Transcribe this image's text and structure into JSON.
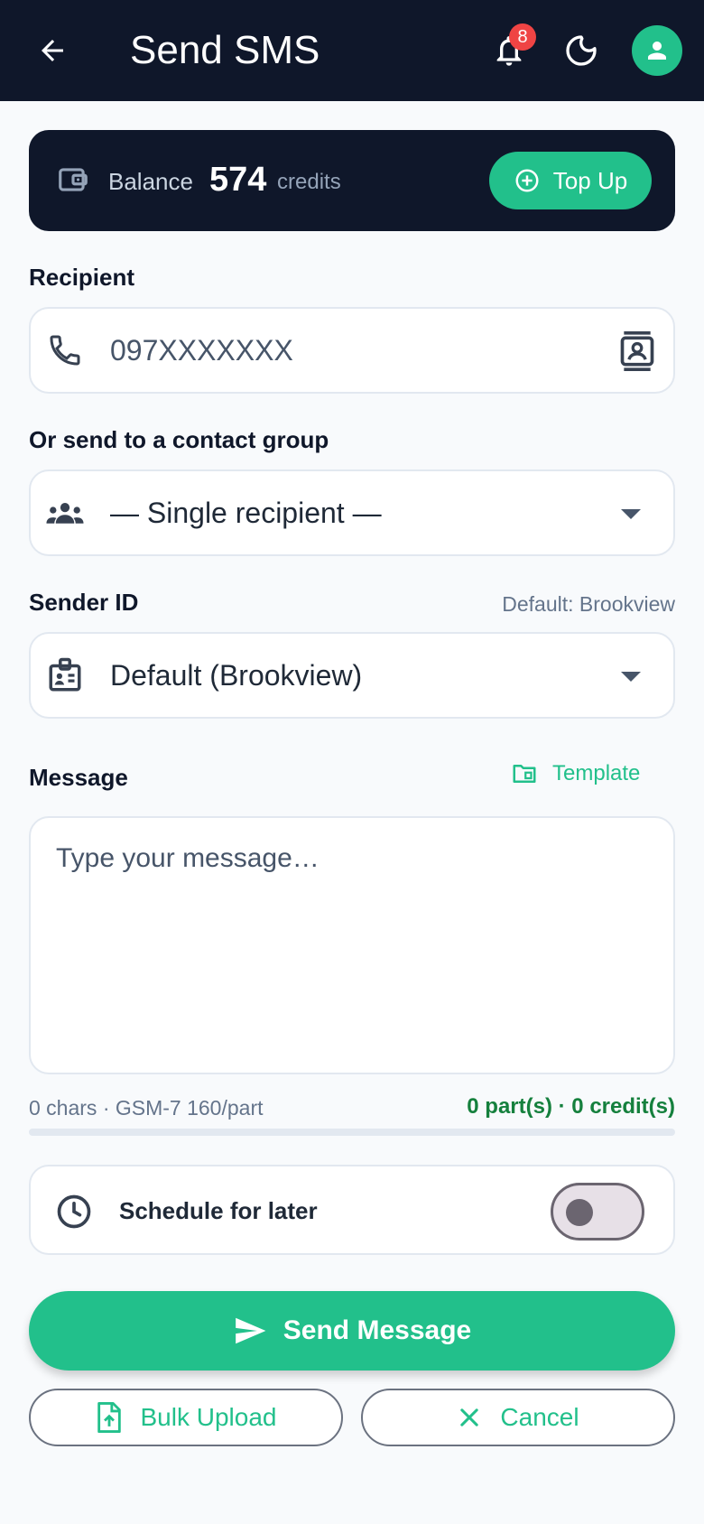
{
  "header": {
    "title": "Send SMS",
    "notification_count": "8"
  },
  "balance": {
    "label": "Balance",
    "amount": "574",
    "unit": "credits",
    "topup_label": "Top Up"
  },
  "recipient": {
    "label": "Recipient",
    "placeholder": "097XXXXXXX"
  },
  "group": {
    "label": "Or send to a contact group",
    "selected": "— Single recipient —"
  },
  "sender": {
    "label": "Sender ID",
    "hint": "Default: Brookview",
    "selected": "Default (Brookview)"
  },
  "message": {
    "label": "Message",
    "template_label": "Template",
    "placeholder": "Type your message…",
    "value": "",
    "char_info": "0 chars · GSM-7 160/part",
    "cost_info": "0 part(s) · 0 credit(s)",
    "progress_fraction": 0
  },
  "schedule": {
    "label": "Schedule for later",
    "enabled": false
  },
  "actions": {
    "send_label": "Send Message",
    "bulk_label": "Bulk Upload",
    "cancel_label": "Cancel"
  },
  "colors": {
    "header_bg": "#0f172a",
    "accent": "#22c08b",
    "badge": "#ef4444",
    "cost_text": "#15803d"
  },
  "icons": [
    "back-arrow-icon",
    "bell-icon",
    "moon-icon",
    "user-icon",
    "wallet-icon",
    "plus-circle-icon",
    "phone-icon",
    "contacts-icon",
    "group-icon",
    "id-badge-icon",
    "folder-icon",
    "clock-icon",
    "send-icon",
    "file-upload-icon",
    "close-icon"
  ]
}
